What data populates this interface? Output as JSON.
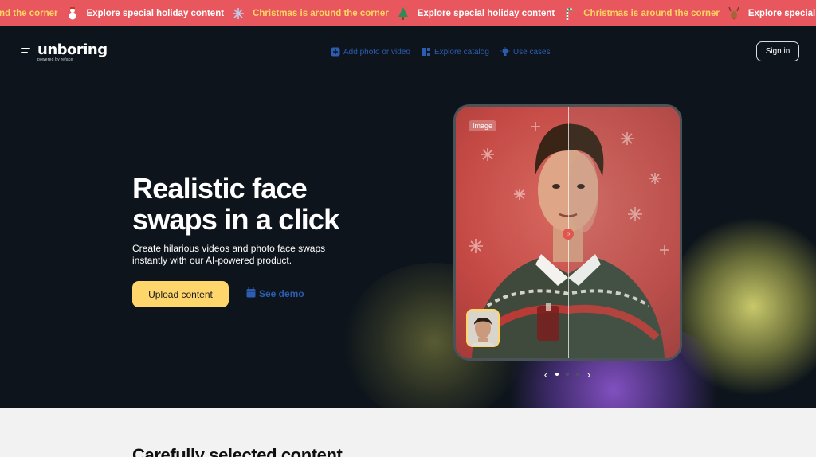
{
  "ticker": {
    "items": [
      {
        "text": "und the corner",
        "tone": "gold",
        "icon": "snowman-icon"
      },
      {
        "text": "Explore special holiday content",
        "tone": "light",
        "icon": "snowflake-icon"
      },
      {
        "text": "Christmas is around the corner",
        "tone": "gold",
        "icon": "christmas-tree-icon"
      },
      {
        "text": "Explore special holiday content",
        "tone": "light",
        "icon": "candy-cane-icon"
      },
      {
        "text": "Christmas is around the corner",
        "tone": "gold",
        "icon": "reindeer-icon"
      },
      {
        "text": "Explore special holiday conte",
        "tone": "light",
        "icon": ""
      }
    ]
  },
  "header": {
    "logo_text": "unboring",
    "logo_sub": "powered by reface",
    "nav": [
      {
        "label": "Add photo or video",
        "icon": "add-media-icon"
      },
      {
        "label": "Explore catalog",
        "icon": "catalog-icon"
      },
      {
        "label": "Use cases",
        "icon": "lightbulb-icon"
      }
    ],
    "signin_label": "Sign in"
  },
  "hero": {
    "title": "Realistic face swaps in a click",
    "subtitle": "Create hilarious videos and photo face swaps instantly with our AI-powered product.",
    "upload_label": "Upload content",
    "demo_label": "See demo",
    "card_tag": "Image",
    "carousel": {
      "total": 3,
      "active": 1
    }
  },
  "lower": {
    "title": "Carefully selected content"
  },
  "colors": {
    "ticker_bg": "#e8575e",
    "page_bg": "#0d141b",
    "accent_yellow": "#fed66b",
    "link_blue": "#2c5db1"
  }
}
